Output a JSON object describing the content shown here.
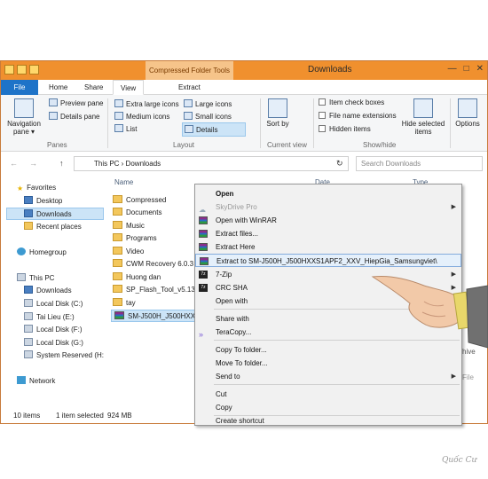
{
  "window": {
    "title": "Downloads",
    "context_tab_group": "Compressed Folder Tools",
    "controls": [
      "—",
      "□",
      "✕"
    ]
  },
  "tabs": [
    "File",
    "Home",
    "Share",
    "View",
    "Extract"
  ],
  "ribbon": {
    "navigation_pane": "Navigation pane",
    "nav_pane_arrow": "▾",
    "preview_pane": "Preview pane",
    "details_pane": "Details pane",
    "panes_label": "Panes",
    "layout_items": [
      "Extra large icons",
      "Large icons",
      "Medium icons",
      "Small icons",
      "List",
      "Details"
    ],
    "layout_label": "Layout",
    "sort_by": "Sort by",
    "current_view_label": "Current view",
    "item_check_boxes": "Item check boxes",
    "file_name_extensions": "File name extensions",
    "hidden_items": "Hidden items",
    "hide_selected_items": "Hide selected items",
    "show_hide_label": "Show/hide",
    "options": "Options"
  },
  "address": {
    "back": "←",
    "forward": "→",
    "up": "↑",
    "path": "This PC  ›  Downloads",
    "refresh": "↻",
    "search_placeholder": "Search Downloads"
  },
  "nav_pane": [
    {
      "label": "Favorites",
      "icon": "star-icon"
    },
    {
      "label": "Desktop",
      "icon": "desktop-icon"
    },
    {
      "label": "Downloads",
      "icon": "downloads-icon"
    },
    {
      "label": "Recent places",
      "icon": "recent-icon"
    },
    {
      "label": "Homegroup",
      "icon": "homegroup-icon"
    },
    {
      "label": "This PC",
      "icon": "pc-icon"
    },
    {
      "label": "Downloads",
      "icon": "downloads-icon"
    },
    {
      "label": "Local Disk (C:)",
      "icon": "drive-icon"
    },
    {
      "label": "Tai Lieu (E:)",
      "icon": "drive-icon"
    },
    {
      "label": "Local Disk (F:)",
      "icon": "drive-icon"
    },
    {
      "label": "Local Disk (G:)",
      "icon": "drive-icon"
    },
    {
      "label": "System Reserved (H:",
      "icon": "drive-icon"
    },
    {
      "label": "Network",
      "icon": "network-icon"
    }
  ],
  "columns": {
    "name": "Name",
    "date": "Date",
    "type": "Type"
  },
  "files": [
    {
      "name": "Compressed",
      "icon": "folder-icon"
    },
    {
      "name": "Documents",
      "icon": "folder-icon"
    },
    {
      "name": "Music",
      "icon": "folder-icon"
    },
    {
      "name": "Programs",
      "icon": "folder-icon"
    },
    {
      "name": "Video",
      "icon": "folder-icon"
    },
    {
      "name": "CWM Recovery 6.0.3",
      "icon": "folder-icon"
    },
    {
      "name": "Huong dan",
      "icon": "folder-icon"
    },
    {
      "name": "SP_Flash_Tool_v5.135",
      "icon": "folder-icon"
    },
    {
      "name": "tay",
      "icon": "folder-icon"
    },
    {
      "name": "SM-J500H_J500HXXS",
      "icon": "rar-icon"
    }
  ],
  "side_fragments": [
    "hive",
    "File"
  ],
  "context_menu": [
    {
      "label": "Open",
      "style": "bold"
    },
    {
      "label": "SkyDrive Pro",
      "style": "disabled",
      "submenu": true
    },
    {
      "label": "Open with WinRAR",
      "icon": "winrar-icon"
    },
    {
      "label": "Extract files...",
      "icon": "winrar-icon"
    },
    {
      "label": "Extract Here",
      "icon": "winrar-icon"
    },
    {
      "label": "Extract to SM-J500H_J500HXXS1APF2_XXV_HiepGia_Samsungviet\\",
      "icon": "winrar-icon",
      "style": "highlight"
    },
    {
      "label": "7-Zip",
      "icon": "7zip-icon",
      "submenu": true
    },
    {
      "label": "CRC SHA",
      "icon": "7zip-icon",
      "submenu": true
    },
    {
      "label": "Open with",
      "submenu": true
    },
    {
      "label": "Share with",
      "submenu": true
    },
    {
      "label": "TeraCopy...",
      "icon": "teracopy-icon"
    },
    {
      "label": "Copy To folder..."
    },
    {
      "label": "Move To folder..."
    },
    {
      "label": "Send to",
      "submenu": true
    },
    {
      "label": "Cut"
    },
    {
      "label": "Copy"
    },
    {
      "label": "Create shortcut"
    }
  ],
  "status": {
    "items": "10 items",
    "selected": "1 item selected",
    "size": "924 MB"
  },
  "watermark": "Quốc Cư"
}
